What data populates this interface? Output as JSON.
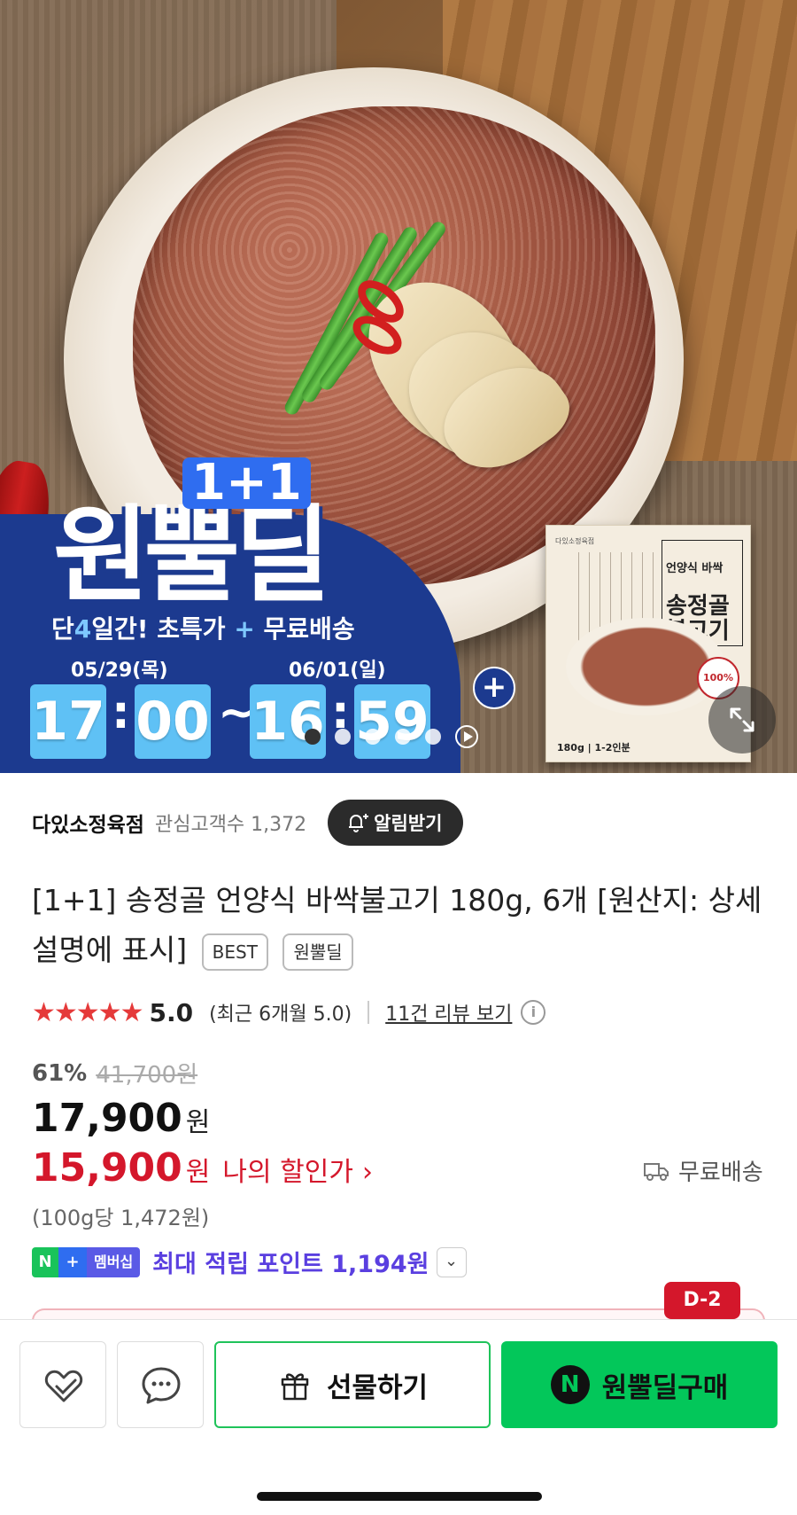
{
  "hero": {
    "promo_oneplus": "1+1",
    "promo_title": "원뿔딜",
    "promo_subtitle_a": "단",
    "promo_subtitle_num": "4",
    "promo_subtitle_b": "일간! 초특가 ",
    "promo_subtitle_plus": "+",
    "promo_subtitle_c": " 무료배송",
    "start_date": "05/29(목)",
    "end_date": "06/01(일)",
    "start_hour": "17",
    "start_min": "00",
    "end_hour": "16",
    "end_min": "59",
    "time_sep": ":",
    "range_sep": "~",
    "package_brand": "다있소정육점",
    "package_title_small": "언양식 바싹",
    "package_title_big": "송정골 불고기",
    "package_weight": "180g | 1-2인분",
    "package_badge": "100%",
    "slide_count": 5,
    "active_slide": 0
  },
  "store": {
    "name": "다있소정육점",
    "fans_label": "관심고객수 1,372",
    "notify_label": "알림받기"
  },
  "product": {
    "title": "[1+1] 송정골 언양식 바싹불고기 180g, 6개 [원산지: 상세설명에 표시]",
    "tags": [
      "BEST",
      "원뿔딜"
    ]
  },
  "rating": {
    "stars": "★★★★★",
    "score": "5.0",
    "recent": "(최근 6개월 5.0)",
    "review_link": "11건 리뷰 보기",
    "info": "i"
  },
  "price": {
    "discount_pct": "61%",
    "original": "41,700원",
    "sale": "17,900",
    "won": "원",
    "my_price": "15,900",
    "my_price_label": "나의 할인가",
    "my_price_chevron": "›",
    "shipping": "무료배송",
    "unit_price": "(100g당 1,472원)"
  },
  "points": {
    "badge_n": "N",
    "badge_plus": "+",
    "badge_member": "멤버십",
    "text": "최대 적립 포인트 1,194원",
    "chevron": "⌄"
  },
  "countdown": {
    "dday": "D-2"
  },
  "bottom": {
    "gift_label": "선물하기",
    "buy_logo": "N",
    "buy_label": "원뿔딜구매"
  },
  "colors": {
    "accent_green": "#03c75a",
    "sale_red": "#d4172b",
    "point_purple": "#5a3fe0",
    "promo_blue": "#1c3a8f"
  }
}
